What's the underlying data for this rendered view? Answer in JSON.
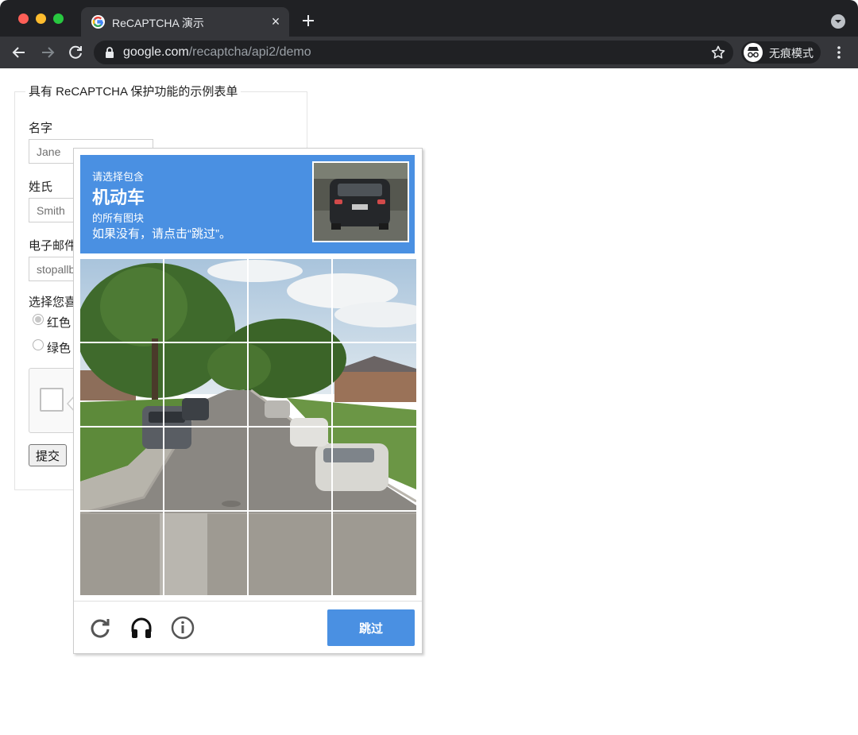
{
  "browser": {
    "tab_title": "ReCAPTCHA 演示",
    "tab_close": "×",
    "url_host": "google.com",
    "url_path": "/recaptcha/api2/demo",
    "incognito_label": "无痕模式",
    "colors": {
      "tabbar": "#202124",
      "toolbar": "#35363a",
      "text": "#e8eaed"
    }
  },
  "form": {
    "legend": "具有 ReCAPTCHA 保护功能的示例表单",
    "first_name_label": "名字",
    "first_name_value": "Jane",
    "last_name_label": "姓氏",
    "last_name_value": "Smith",
    "email_label": "电子邮件",
    "email_value": "stopallbots@gmail.com",
    "color_label": "选择您喜欢的颜色",
    "radio_red": "红色",
    "radio_green": "绿色",
    "submit_label": "提交"
  },
  "challenge": {
    "line1": "请选择包含",
    "keyword": "机动车",
    "line2": "的所有图块",
    "line3": "如果没有，请点击“跳过”。",
    "skip_label": "跳过",
    "grid_size": 4,
    "accent_color": "#4a90e2",
    "footer_icons": [
      "reload-icon",
      "headphones-icon",
      "info-icon"
    ]
  }
}
